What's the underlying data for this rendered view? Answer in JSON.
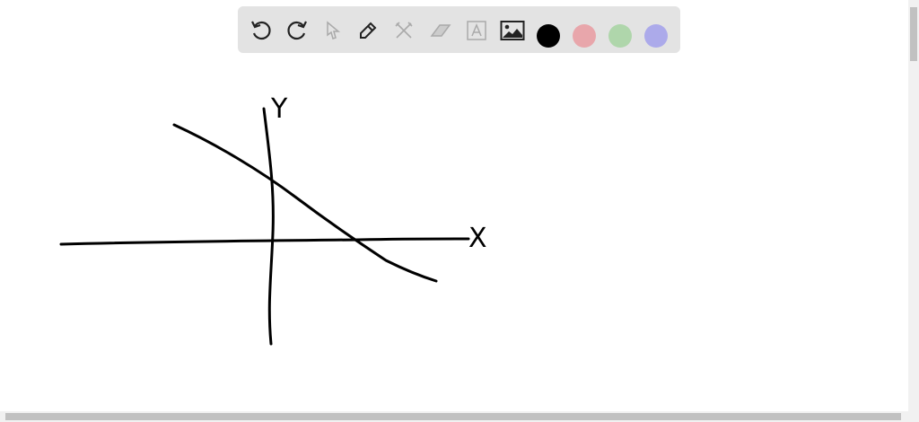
{
  "toolbar": {
    "tools": [
      "undo-icon",
      "redo-icon",
      "select-icon",
      "pen-icon",
      "tools-icon",
      "eraser-icon",
      "text-icon",
      "image-icon"
    ],
    "colors": {
      "black": "#000000",
      "red": "#e8a6ab",
      "green": "#afd6ab",
      "blue": "#acaaea"
    },
    "bg": "#e3e3e3"
  },
  "drawing": {
    "y_label": "Y",
    "x_label": "X"
  }
}
